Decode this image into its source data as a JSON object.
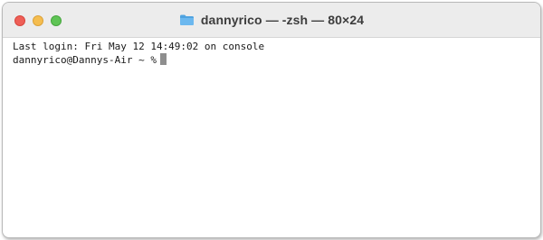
{
  "window": {
    "title": "dannyrico — -zsh — 80×24",
    "title_icon": "folder-icon",
    "buttons": {
      "close": "close-button",
      "minimize": "minimize-button",
      "maximize": "maximize-button"
    },
    "colors": {
      "close": "#ee5f57",
      "minimize": "#f5bd4f",
      "maximize": "#5fc455",
      "folder": "#4fa3e0"
    }
  },
  "terminal": {
    "last_login": "Last login: Fri May 12 14:49:02 on console",
    "prompt": "dannyrico@Dannys-Air ~ %"
  }
}
